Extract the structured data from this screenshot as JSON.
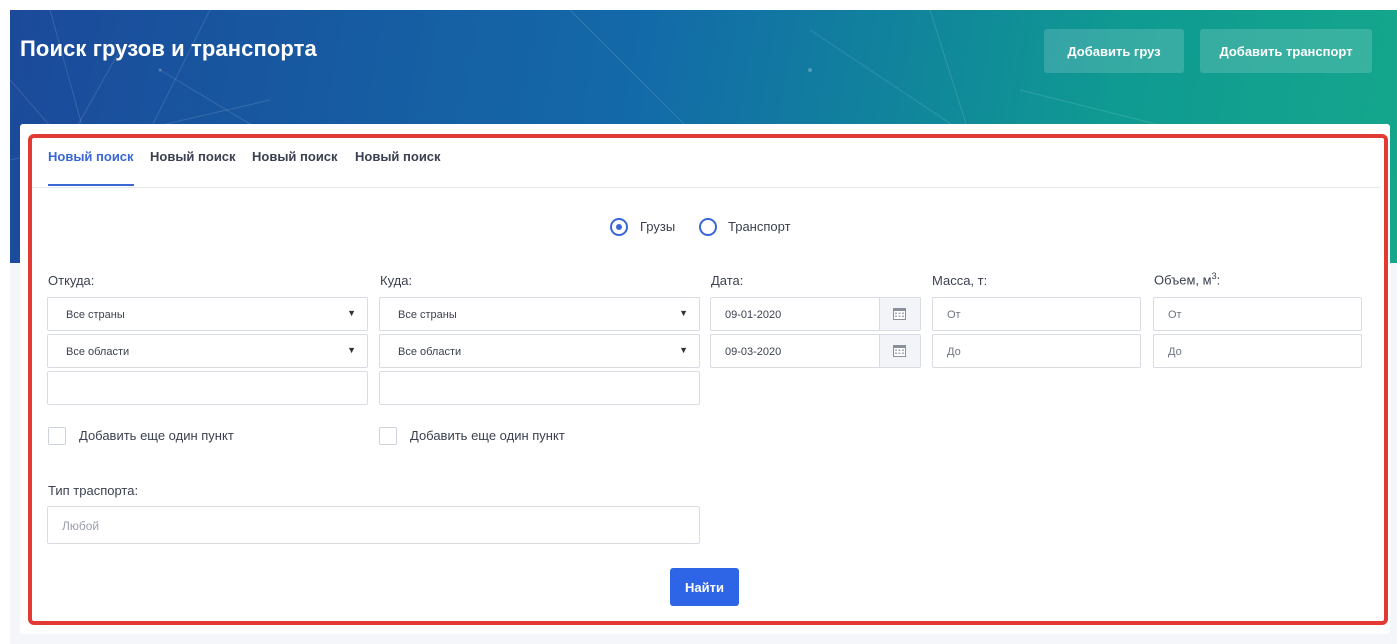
{
  "header": {
    "title": "Поиск грузов и транспорта",
    "add_cargo_label": "Добавить груз",
    "add_transport_label": "Добавить транспорт"
  },
  "tabs": [
    {
      "label": "Новый поиск",
      "active": true
    },
    {
      "label": "Новый поиск",
      "active": false
    },
    {
      "label": "Новый поиск",
      "active": false
    },
    {
      "label": "Новый поиск",
      "active": false
    }
  ],
  "mode": {
    "options": [
      {
        "label": "Грузы",
        "checked": true
      },
      {
        "label": "Транспорт",
        "checked": false
      }
    ]
  },
  "form": {
    "from": {
      "label": "Откуда:",
      "country": "Все страны",
      "region": "Все области",
      "city": "",
      "add_point_label": "Добавить еще один пункт"
    },
    "to": {
      "label": "Куда:",
      "country": "Все страны",
      "region": "Все области",
      "city": "",
      "add_point_label": "Добавить еще один пункт"
    },
    "date": {
      "label": "Дата:",
      "from": "09-01-2020",
      "to": "09-03-2020"
    },
    "mass": {
      "label": "Масса, т:",
      "from_placeholder": "От",
      "to_placeholder": "До"
    },
    "volume": {
      "label": "Объем, м",
      "label_sup": "3",
      "label_suffix": ":",
      "from_placeholder": "От",
      "to_placeholder": "До"
    },
    "transport_type": {
      "label": "Тип траспорта:",
      "placeholder": "Любой"
    },
    "submit_label": "Найти"
  },
  "colors": {
    "accent": "#3a67d6",
    "button": "#2e64e6",
    "highlight": "#e23a33"
  }
}
